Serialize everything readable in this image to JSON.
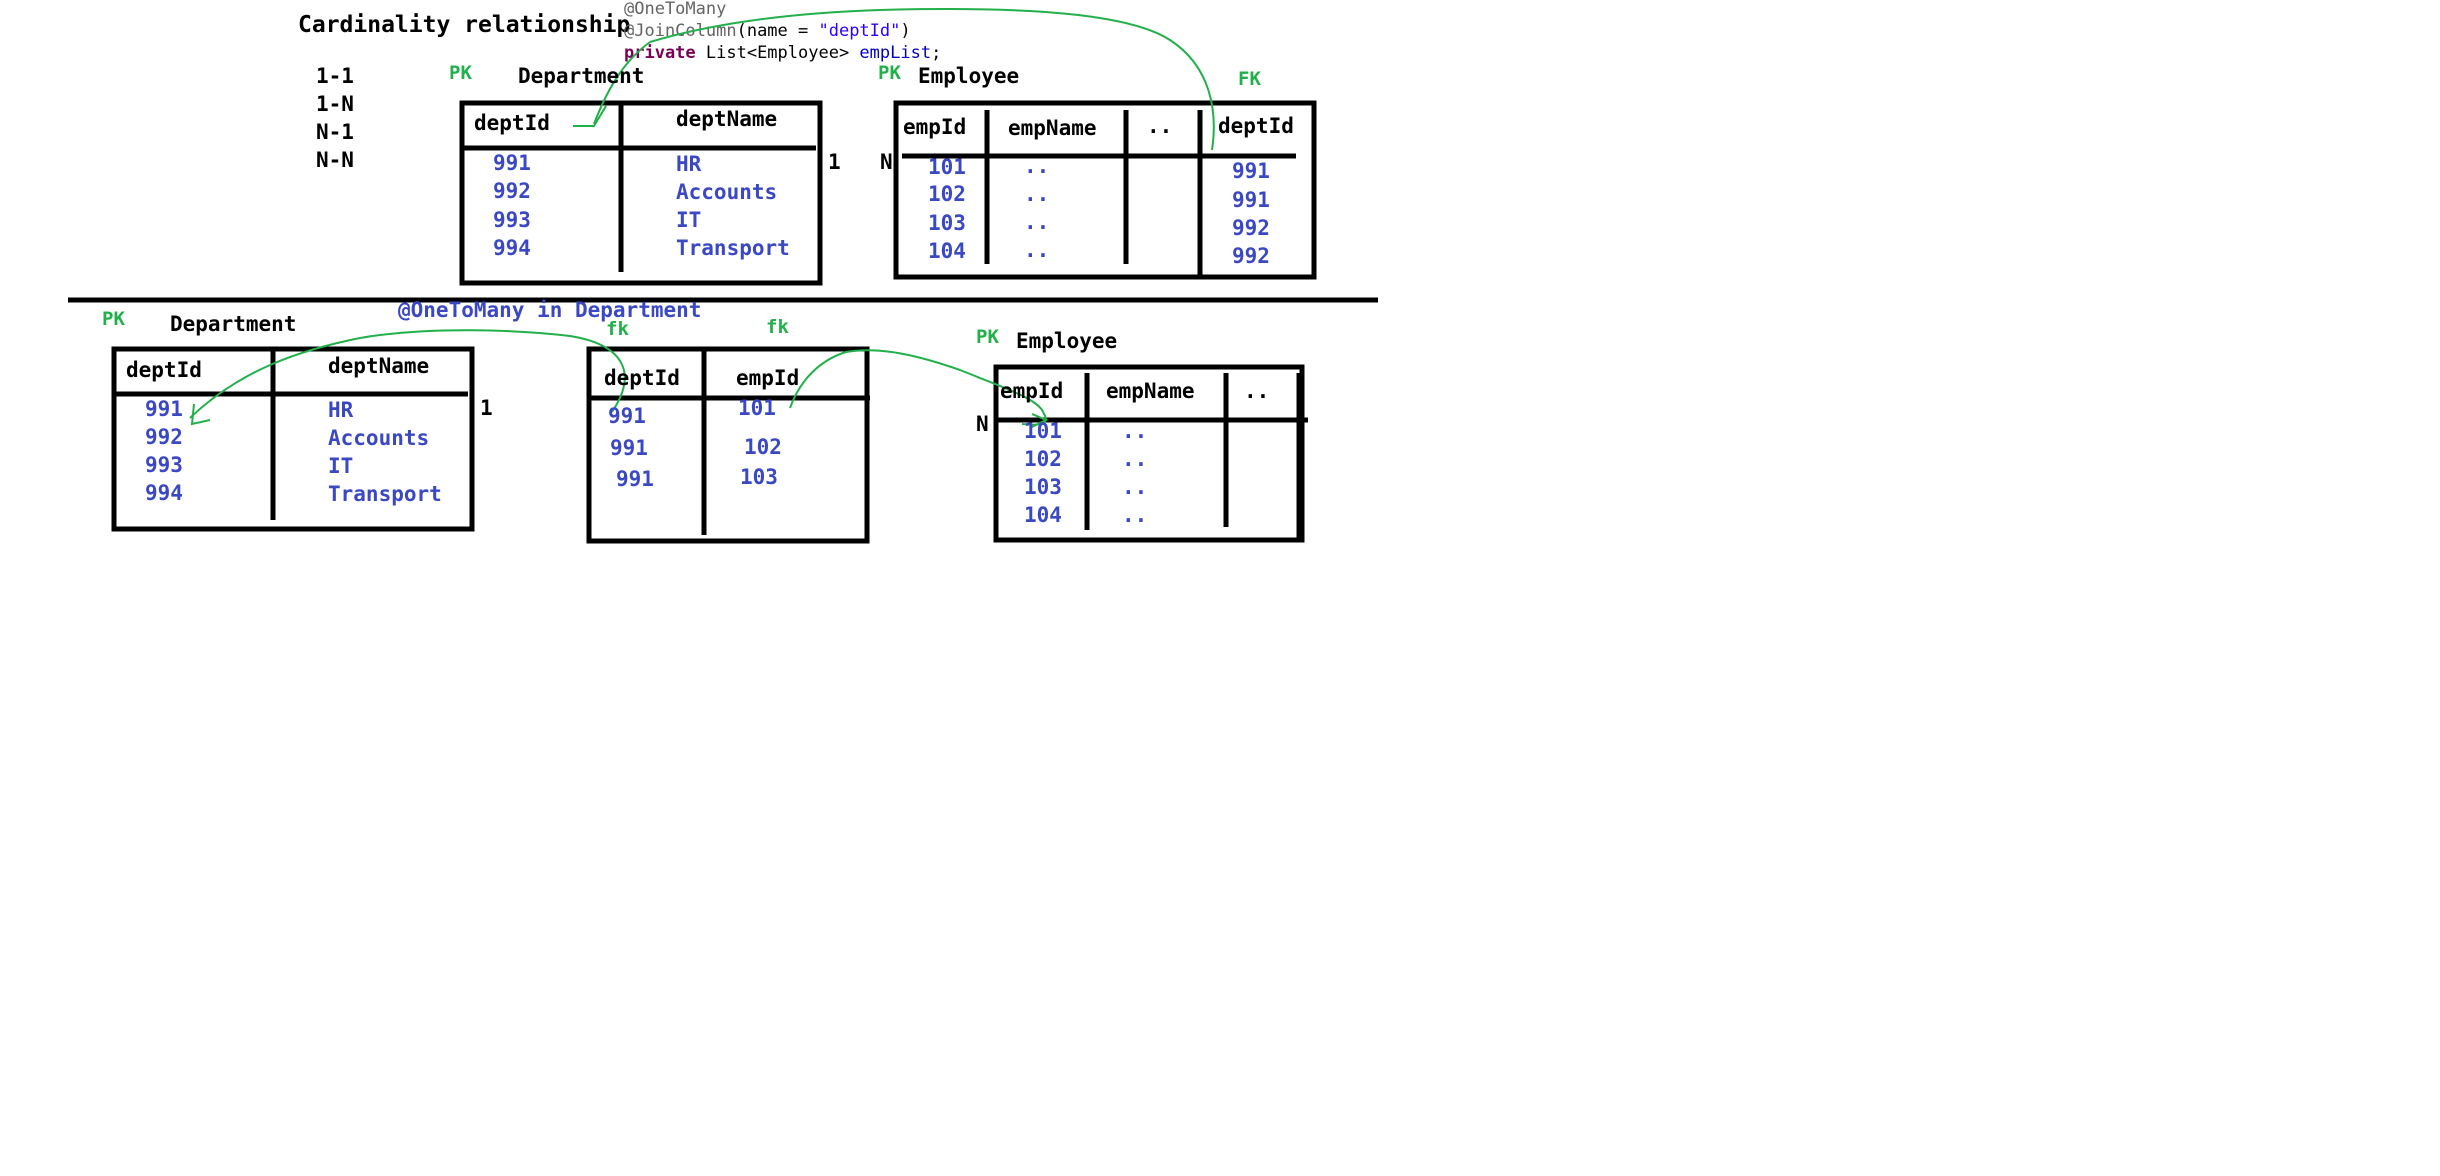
{
  "title": "Cardinality relationship",
  "cardinalities": [
    "1-1",
    "1-N",
    "N-1",
    "N-N"
  ],
  "code": {
    "line1": "@OneToMany",
    "line2_ann": "@JoinColumn",
    "line2_open": "(name = ",
    "line2_str": "\"deptId\"",
    "line2_close": ")",
    "line3_kw": "private",
    "line3_type": " List<Employee> ",
    "line3_field": "empList",
    "line3_end": ";"
  },
  "top": {
    "dept_pk": "PK",
    "dept_title": "Department",
    "dept_headers": [
      "deptId",
      "deptName"
    ],
    "dept_ids": [
      "991",
      "992",
      "993",
      "994"
    ],
    "dept_names": [
      "HR",
      "Accounts",
      "IT",
      "Transport"
    ],
    "one": "1",
    "many": "N",
    "emp_pk": "PK",
    "emp_title": "Employee",
    "emp_fk": "FK",
    "emp_headers": [
      "empId",
      "empName",
      "..",
      "deptId"
    ],
    "emp_ids": [
      "101",
      "102",
      "103",
      "104"
    ],
    "emp_names": [
      "..",
      "..",
      "..",
      ".."
    ],
    "emp_dept_ids": [
      "991",
      "991",
      "992",
      "992"
    ]
  },
  "bottom": {
    "annotation": "@OneToMany in Department",
    "dept_pk": "PK",
    "dept_title": "Department",
    "dept_headers": [
      "deptId",
      "deptName"
    ],
    "dept_ids": [
      "991",
      "992",
      "993",
      "994"
    ],
    "dept_names": [
      "HR",
      "Accounts",
      "IT",
      "Transport"
    ],
    "one": "1",
    "join_fk1": "fk",
    "join_fk2": "fk",
    "join_headers": [
      "deptId",
      "empId"
    ],
    "join_dept_ids": [
      "991",
      "991",
      "991"
    ],
    "join_emp_ids": [
      "101",
      "102",
      "103"
    ],
    "many": "N",
    "emp_pk": "PK",
    "emp_title": "Employee",
    "emp_headers": [
      "empId",
      "empName",
      ".."
    ],
    "emp_ids": [
      "101",
      "102",
      "103",
      "104"
    ],
    "emp_names": [
      "..",
      "..",
      "..",
      ".."
    ]
  },
  "colors": {
    "ink": "#000000",
    "pen_blue": "#3b48c4",
    "pen_green": "#22b04b"
  }
}
